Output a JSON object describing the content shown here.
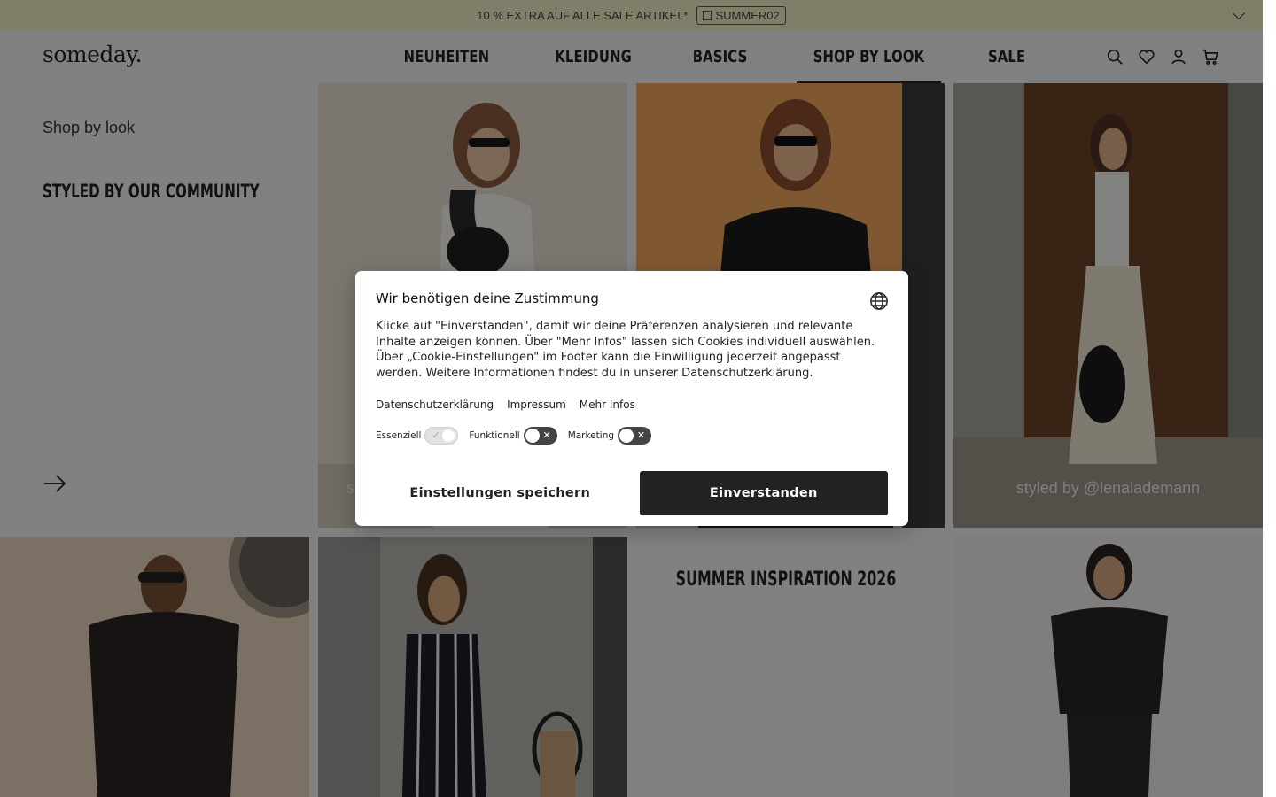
{
  "promo": {
    "text": "10 % EXTRA AUF ALLE SALE ARTIKEL*",
    "code": "SUMMER02"
  },
  "header": {
    "logo": "someday.",
    "nav": [
      "NEUHEITEN",
      "KLEIDUNG",
      "BASICS",
      "SHOP BY LOOK",
      "SALE"
    ],
    "active_nav": "SHOP BY LOOK",
    "icons": [
      "search-icon",
      "heart-icon",
      "account-icon",
      "cart-icon"
    ]
  },
  "sidebar": {
    "breadcrumb": "Shop by look",
    "heading": "STYLED BY OUR COMMUNITY"
  },
  "tiles": {
    "caption_first_partial": "s",
    "caption_third": "styled by @lenalademann",
    "summer_title": "SUMMER INSPIRATION 2026"
  },
  "consent": {
    "title": "Wir benötigen deine Zustimmung",
    "body": "Klicke auf \"Einverstanden\", damit wir deine Präferenzen analysieren und relevante Inhalte anzeigen können. Über \"Mehr Infos\" lassen sich Cookies individuell auswählen. Über „Cookie-Einstellungen\" im Footer kann die Einwilligung jederzeit angepasst werden. Weitere Informationen findest du in unserer Datenschutzerklärung.",
    "links": [
      "Datenschutzerklärung",
      "Impressum",
      "Mehr Infos"
    ],
    "toggles": [
      {
        "label": "Essenziell",
        "state": "on-disabled"
      },
      {
        "label": "Funktionell",
        "state": "off"
      },
      {
        "label": "Marketing",
        "state": "off"
      }
    ],
    "save_button": "Einstellungen speichern",
    "accept_button": "Einverstanden"
  },
  "colors": {
    "promo_bg": "#f2ecc4",
    "primary_button": "#222222",
    "overlay": "rgba(0,0,0,0.47)"
  }
}
